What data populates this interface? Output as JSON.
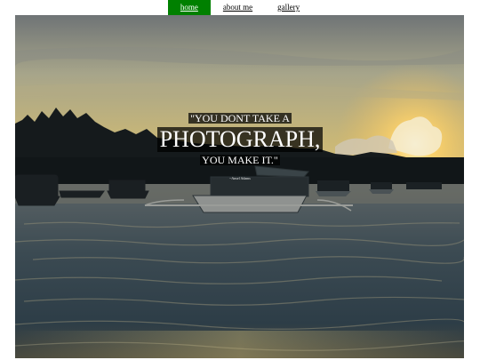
{
  "nav": {
    "items": [
      {
        "label": "home",
        "active": true
      },
      {
        "label": "about me",
        "active": false
      },
      {
        "label": "gallery",
        "active": false
      }
    ],
    "active_color": "#008000"
  },
  "quote": {
    "line1": "\"YOU DONT TAKE A",
    "line2": "PHOTOGRAPH,",
    "line3": "YOU MAKE IT.\"",
    "author": "~Ansel Adams"
  }
}
